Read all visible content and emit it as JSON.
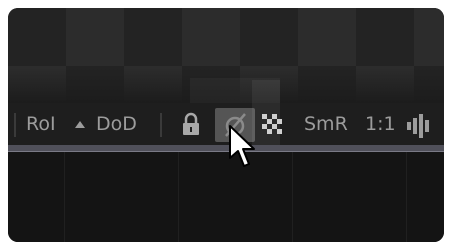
{
  "toolbar": {
    "roi_label": "RoI",
    "dod_label": "DoD",
    "smr_label": "SmR",
    "zoom_label": "1:1"
  },
  "icons": {
    "roi_arrow": "triangle-up-icon",
    "lock": "lock-icon",
    "proxy": "circle-slash-icon",
    "checker": "checkerboard-icon",
    "levels": "bars-icon"
  },
  "colors": {
    "text": "#9c9c9c",
    "active_button": "#555555",
    "track": "#50505a"
  }
}
